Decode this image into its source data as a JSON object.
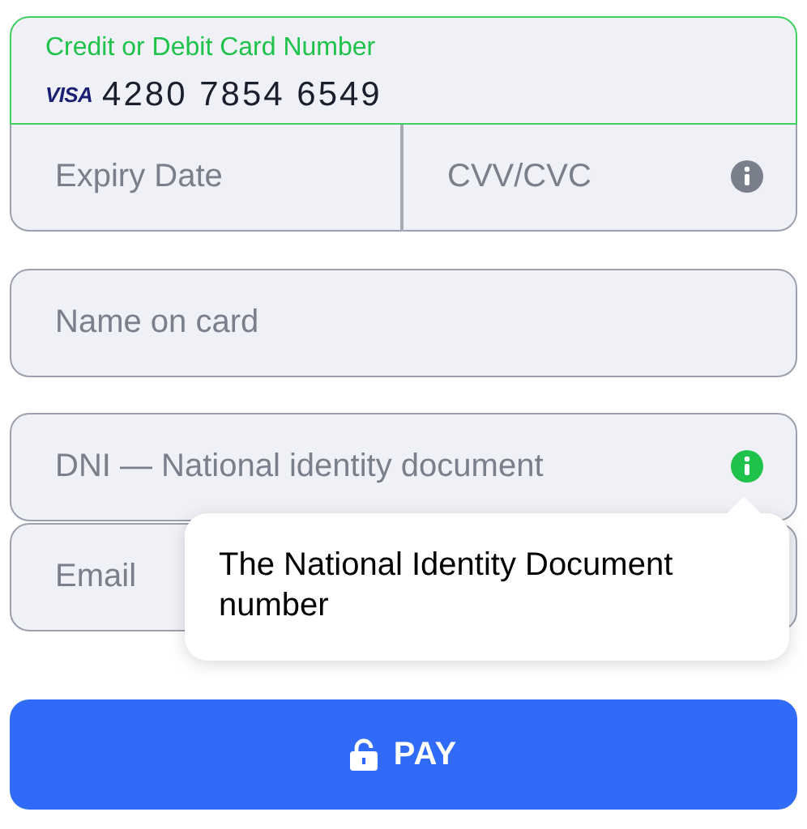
{
  "card_number": {
    "label": "Credit or Debit Card Number",
    "brand": "VISA",
    "value": "4280 7854 6549",
    "focused": true
  },
  "expiry": {
    "placeholder": "Expiry Date"
  },
  "cvv": {
    "placeholder": "CVV/CVC",
    "tooltip_open": false
  },
  "name": {
    "placeholder": "Name on card"
  },
  "dni": {
    "placeholder": "DNI — National identity document",
    "tooltip_open": true,
    "tooltip": "The National Identity Document number"
  },
  "email": {
    "placeholder": "Email"
  },
  "pay_button": {
    "label": "PAY"
  }
}
